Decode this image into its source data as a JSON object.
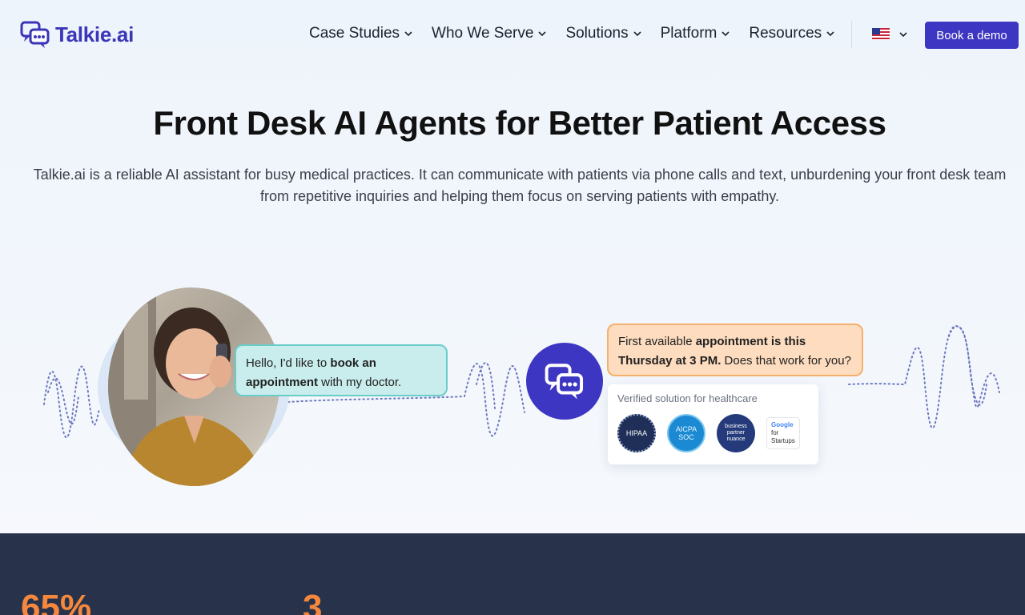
{
  "brand": {
    "name": "Talkie.ai",
    "color": "#3b35b8"
  },
  "nav": {
    "items": [
      {
        "label": "Case Studies"
      },
      {
        "label": "Who We Serve"
      },
      {
        "label": "Solutions"
      },
      {
        "label": "Platform"
      },
      {
        "label": "Resources"
      }
    ],
    "language_icon": "us-flag-icon",
    "cta": "Book a demo"
  },
  "hero": {
    "title": "Front Desk AI Agents for Better Patient Access",
    "subtitle": "Talkie.ai is a reliable AI assistant for busy medical practices. It can communicate with patients via phone calls and text, unburdening your front desk team from repetitive inquiries and helping them focus on serving patients with empathy."
  },
  "illustration": {
    "patient_msg": {
      "p1": "Hello, I'd like to ",
      "b1": "book an appointment",
      "p2": " with my doctor."
    },
    "agent_msg": {
      "p1": "First available ",
      "b1": "appointment is this Thursday at 3 PM.",
      "p2": " Does that work for you?"
    },
    "verified_title": "Verified solution for healthcare",
    "badges": {
      "hipaa": "HIPAA",
      "aicpa_l1": "AICPA",
      "aicpa_l2": "SOC",
      "bp_l1": "business",
      "bp_l2": "partner",
      "bp_l3": "nuance",
      "google_l1": "Google",
      "google_l2": "for",
      "google_l3": "Startups"
    }
  },
  "stats": {
    "stat1": "65%",
    "stat2": "3"
  },
  "colors": {
    "primary": "#3d36c2",
    "accent_orange": "#f5883c",
    "dark_band": "#28334b",
    "teal_bubble": "#c9ecec",
    "peach_bubble": "#fddcbf"
  }
}
